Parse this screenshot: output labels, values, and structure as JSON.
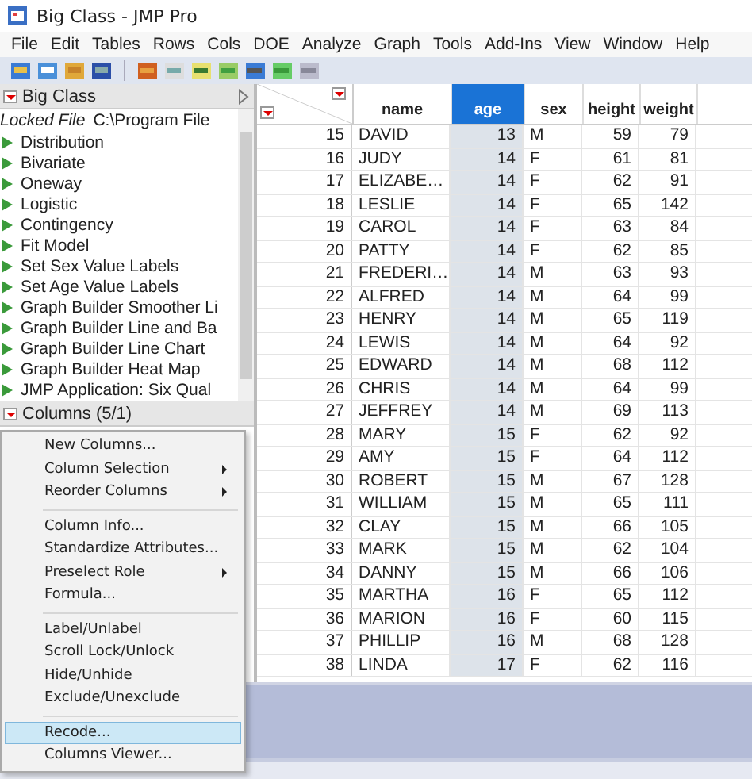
{
  "window": {
    "title": "Big Class - JMP Pro"
  },
  "menu_bar": [
    "File",
    "Edit",
    "Tables",
    "Rows",
    "Cols",
    "DOE",
    "Analyze",
    "Graph",
    "Tools",
    "Add-Ins",
    "View",
    "Window",
    "Help"
  ],
  "left_panel": {
    "title": "Big Class",
    "locked_label": "Locked File",
    "locked_path": "C:\\Program File",
    "scripts": [
      "Distribution",
      "Bivariate",
      "Oneway",
      "Logistic",
      "Contingency",
      "Fit Model",
      "Set Sex Value Labels",
      "Set Age Value Labels",
      "Graph Builder Smoother Li",
      "Graph Builder Line and Ba",
      "Graph Builder Line Chart",
      "Graph Builder Heat Map",
      "JMP Application: Six Qual"
    ],
    "columns_header": "Columns (5/1)"
  },
  "table": {
    "columns": [
      {
        "label": "name",
        "selected": false
      },
      {
        "label": "age",
        "selected": true
      },
      {
        "label": "sex",
        "selected": false
      },
      {
        "label": "height",
        "selected": false
      },
      {
        "label": "weight",
        "selected": false
      }
    ],
    "rows": [
      {
        "row": "15",
        "cells": [
          "DAVID",
          "13",
          "M",
          "59",
          "79"
        ]
      },
      {
        "row": "16",
        "cells": [
          "JUDY",
          "14",
          "F",
          "61",
          "81"
        ]
      },
      {
        "row": "17",
        "cells": [
          "ELIZABE…",
          "14",
          "F",
          "62",
          "91"
        ]
      },
      {
        "row": "18",
        "cells": [
          "LESLIE",
          "14",
          "F",
          "65",
          "142"
        ]
      },
      {
        "row": "19",
        "cells": [
          "CAROL",
          "14",
          "F",
          "63",
          "84"
        ]
      },
      {
        "row": "20",
        "cells": [
          "PATTY",
          "14",
          "F",
          "62",
          "85"
        ]
      },
      {
        "row": "21",
        "cells": [
          "FREDERI…",
          "14",
          "M",
          "63",
          "93"
        ]
      },
      {
        "row": "22",
        "cells": [
          "ALFRED",
          "14",
          "M",
          "64",
          "99"
        ]
      },
      {
        "row": "23",
        "cells": [
          "HENRY",
          "14",
          "M",
          "65",
          "119"
        ]
      },
      {
        "row": "24",
        "cells": [
          "LEWIS",
          "14",
          "M",
          "64",
          "92"
        ]
      },
      {
        "row": "25",
        "cells": [
          "EDWARD",
          "14",
          "M",
          "68",
          "112"
        ]
      },
      {
        "row": "26",
        "cells": [
          "CHRIS",
          "14",
          "M",
          "64",
          "99"
        ]
      },
      {
        "row": "27",
        "cells": [
          "JEFFREY",
          "14",
          "M",
          "69",
          "113"
        ]
      },
      {
        "row": "28",
        "cells": [
          "MARY",
          "15",
          "F",
          "62",
          "92"
        ]
      },
      {
        "row": "29",
        "cells": [
          "AMY",
          "15",
          "F",
          "64",
          "112"
        ]
      },
      {
        "row": "30",
        "cells": [
          "ROBERT",
          "15",
          "M",
          "67",
          "128"
        ]
      },
      {
        "row": "31",
        "cells": [
          "WILLIAM",
          "15",
          "M",
          "65",
          "111"
        ]
      },
      {
        "row": "32",
        "cells": [
          "CLAY",
          "15",
          "M",
          "66",
          "105"
        ]
      },
      {
        "row": "33",
        "cells": [
          "MARK",
          "15",
          "M",
          "62",
          "104"
        ]
      },
      {
        "row": "34",
        "cells": [
          "DANNY",
          "15",
          "M",
          "66",
          "106"
        ]
      },
      {
        "row": "35",
        "cells": [
          "MARTHA",
          "16",
          "F",
          "65",
          "112"
        ]
      },
      {
        "row": "36",
        "cells": [
          "MARION",
          "16",
          "F",
          "60",
          "115"
        ]
      },
      {
        "row": "37",
        "cells": [
          "PHILLIP",
          "16",
          "M",
          "68",
          "128"
        ]
      },
      {
        "row": "38",
        "cells": [
          "LINDA",
          "17",
          "F",
          "62",
          "116"
        ]
      }
    ]
  },
  "context_menu": {
    "groups": [
      [
        {
          "label": "New Columns...",
          "submenu": false,
          "selected": false
        },
        {
          "label": "Column Selection",
          "submenu": true,
          "selected": false
        },
        {
          "label": "Reorder Columns",
          "submenu": true,
          "selected": false
        }
      ],
      [
        {
          "label": "Column Info...",
          "submenu": false,
          "selected": false
        },
        {
          "label": "Standardize Attributes...",
          "submenu": false,
          "selected": false
        },
        {
          "label": "Preselect Role",
          "submenu": true,
          "selected": false
        },
        {
          "label": "Formula...",
          "submenu": false,
          "selected": false
        }
      ],
      [
        {
          "label": "Label/Unlabel",
          "submenu": false,
          "selected": false
        },
        {
          "label": "Scroll Lock/Unlock",
          "submenu": false,
          "selected": false
        },
        {
          "label": "Hide/Unhide",
          "submenu": false,
          "selected": false
        },
        {
          "label": "Exclude/Unexclude",
          "submenu": false,
          "selected": false
        }
      ],
      [
        {
          "label": "Recode...",
          "submenu": false,
          "selected": true
        },
        {
          "label": "Columns Viewer...",
          "submenu": false,
          "selected": false
        }
      ]
    ]
  }
}
